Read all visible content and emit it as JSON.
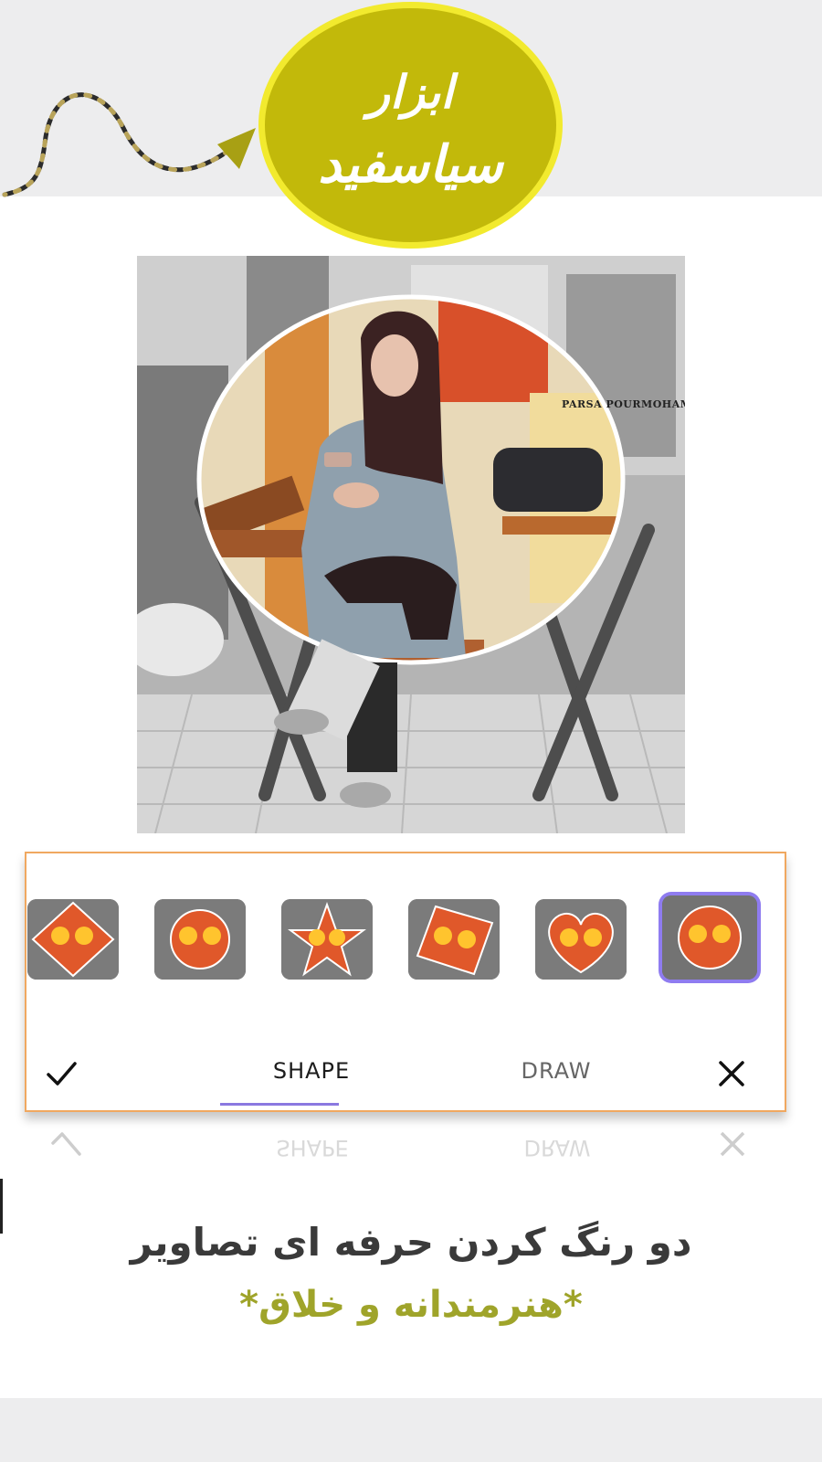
{
  "badge": {
    "line1": "ابزار",
    "line2": "سیاسفید",
    "fill_color": "#c2b90a",
    "ring_color": "#f2ea2e"
  },
  "photo": {
    "watermark": "PARSA POURMOHAMMAD"
  },
  "shape_thumbnails": [
    {
      "shape": "diamond"
    },
    {
      "shape": "circle"
    },
    {
      "shape": "star"
    },
    {
      "shape": "tilted-square"
    },
    {
      "shape": "heart"
    },
    {
      "shape": "circle-selected"
    }
  ],
  "tabs": {
    "confirm_icon": "check-icon",
    "shape_label": "SHAPE",
    "draw_label": "DRAW",
    "close_icon": "close-icon",
    "active_tab": "SHAPE"
  },
  "caption": {
    "line1": "دو رنگ کردن حرفه ای تصاویر",
    "line2": "*هنرمندانه و خلاق*"
  },
  "colors": {
    "accent": "#8a78e0",
    "panel_border": "#f0a860",
    "caption_accent": "#9fa42a"
  }
}
